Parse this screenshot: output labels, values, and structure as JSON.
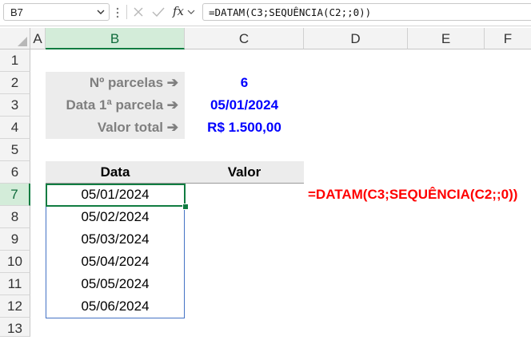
{
  "formula_bar": {
    "name_box": "B7",
    "fx_label": "fx",
    "formula": "=DATAM(C3;SEQUÊNCIA(C2;;0))"
  },
  "columns": [
    "A",
    "B",
    "C",
    "D",
    "E",
    "F"
  ],
  "rows": [
    "1",
    "2",
    "3",
    "4",
    "5",
    "6",
    "7",
    "8",
    "9",
    "10",
    "11",
    "12",
    "13"
  ],
  "params": [
    {
      "label": "Nº parcelas ➔",
      "value": "6"
    },
    {
      "label": "Data 1ª parcela ➔",
      "value": "05/01/2024"
    },
    {
      "label": "Valor total ➔",
      "value": "R$ 1.500,00"
    }
  ],
  "table": {
    "header_data": "Data",
    "header_valor": "Valor",
    "dates": [
      "05/01/2024",
      "05/02/2024",
      "05/03/2024",
      "05/04/2024",
      "05/05/2024",
      "05/06/2024"
    ]
  },
  "annotation": "=DATAM(C3;SEQUÊNCIA(C2;;0))",
  "colors": {
    "selection": "#107c41",
    "value_text": "#0000ff",
    "annotation_text": "#ff0000",
    "label_fill": "#ececec",
    "spill_border": "#4472c4"
  }
}
